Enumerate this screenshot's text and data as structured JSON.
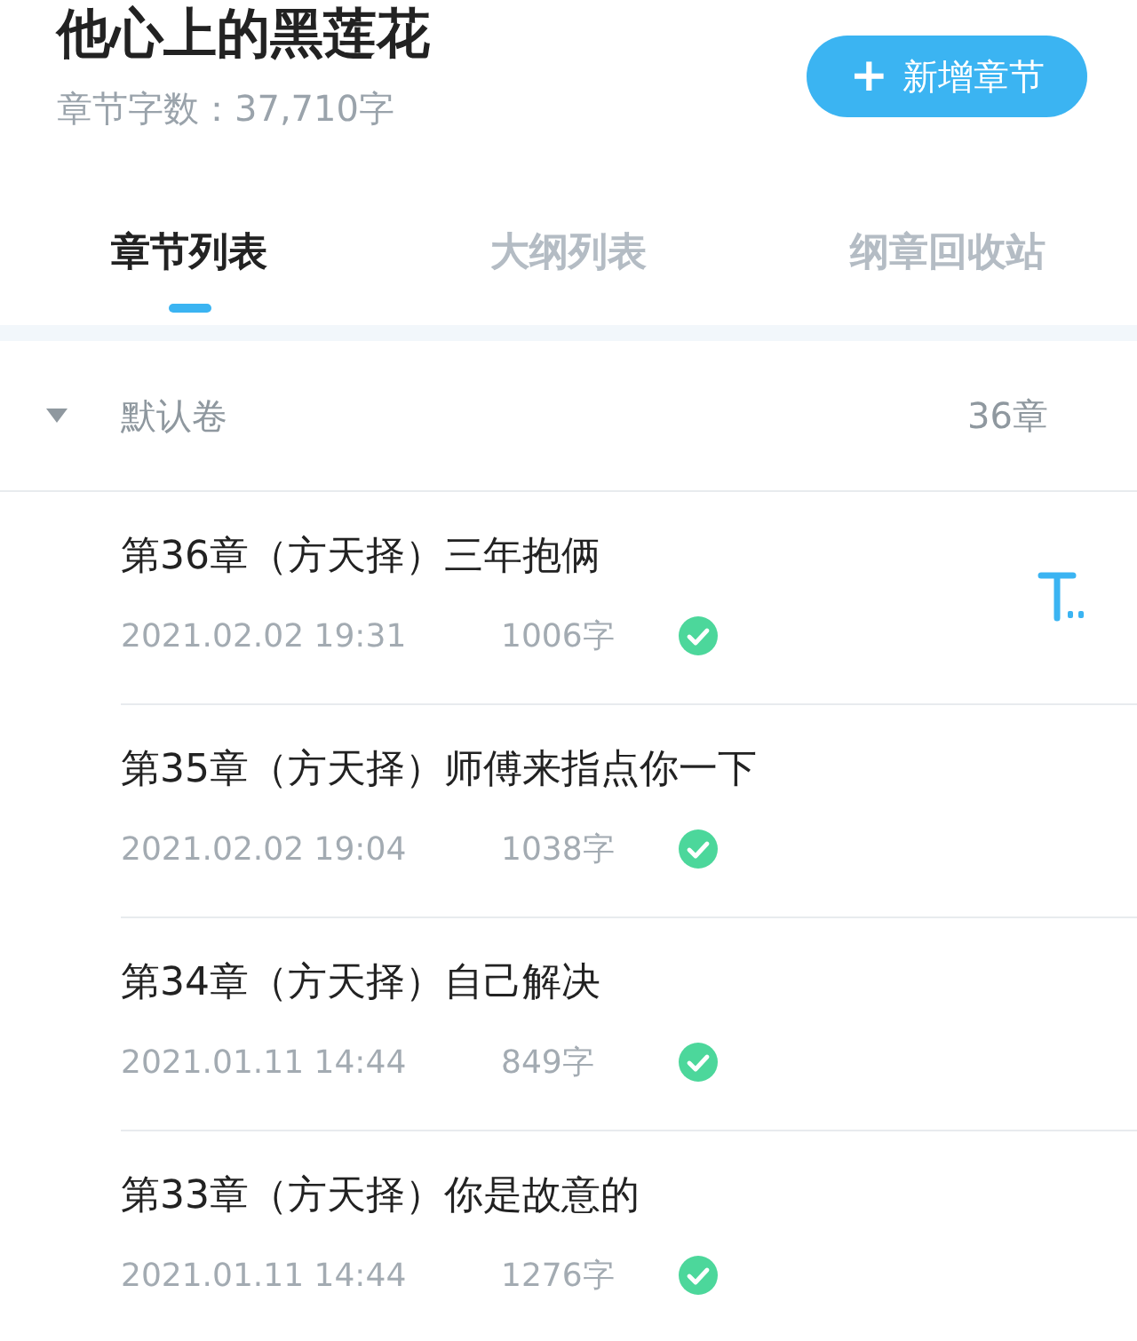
{
  "header": {
    "title": "他心上的黑莲花",
    "word_count": "章节字数：37,710字",
    "add_button": {
      "icon": "+",
      "label": "新增章节"
    }
  },
  "tabs": [
    {
      "label": "章节列表",
      "selected": true
    },
    {
      "label": "大纲列表",
      "selected": false
    },
    {
      "label": "纲章回收站",
      "selected": false
    }
  ],
  "volume": {
    "name": "默认卷",
    "count": "36章",
    "expanded": true
  },
  "chapters": [
    {
      "title": "第36章（方天择）三年抱俩",
      "time": "2021.02.02 19:31",
      "words": "1006字",
      "published": true,
      "edit_icon": true
    },
    {
      "title": "第35章（方天择）师傅来指点你一下",
      "time": "2021.02.02 19:04",
      "words": "1038字",
      "published": true,
      "edit_icon": false
    },
    {
      "title": "第34章（方天择）自己解决",
      "time": "2021.01.11 14:44",
      "words": "849字",
      "published": true,
      "edit_icon": false
    },
    {
      "title": "第33章（方天择）你是故意的",
      "time": "2021.01.11 14:44",
      "words": "1276字",
      "published": true,
      "edit_icon": false
    }
  ]
}
